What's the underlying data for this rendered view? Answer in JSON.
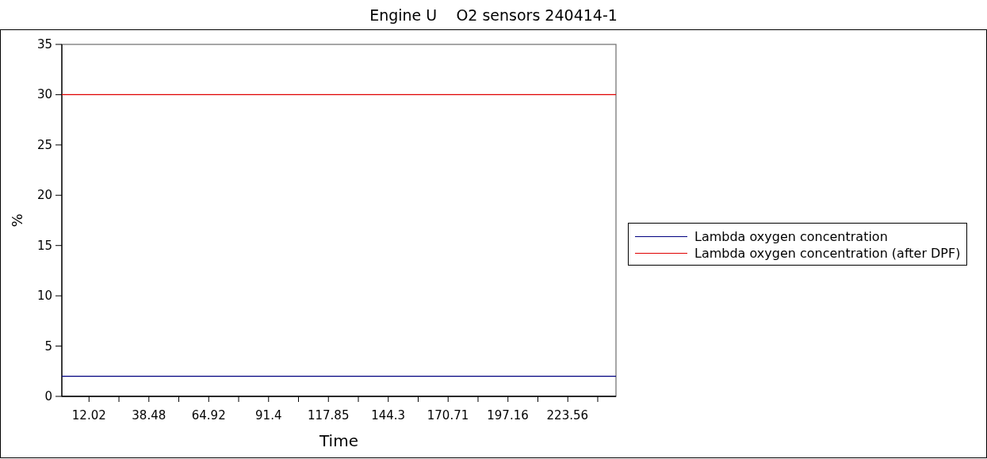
{
  "title": "Engine U    O2 sensors 240414-1",
  "chart_data": {
    "type": "line",
    "xlabel": "Time",
    "ylabel": "%",
    "x": [
      0,
      245
    ],
    "xlim": [
      0,
      245
    ],
    "ylim": [
      0,
      35
    ],
    "xticks": [
      12.02,
      38.48,
      64.92,
      91.4,
      117.85,
      144.3,
      170.71,
      197.16,
      223.56
    ],
    "yticks": [
      0,
      5,
      10,
      15,
      20,
      25,
      30,
      35
    ],
    "series": [
      {
        "name": "Lambda oxygen concentration",
        "color": "#00007f",
        "values": [
          2,
          2
        ]
      },
      {
        "name": "Lambda oxygen concentration (after DPF)",
        "color": "#e00000",
        "values": [
          30,
          30
        ]
      }
    ]
  }
}
